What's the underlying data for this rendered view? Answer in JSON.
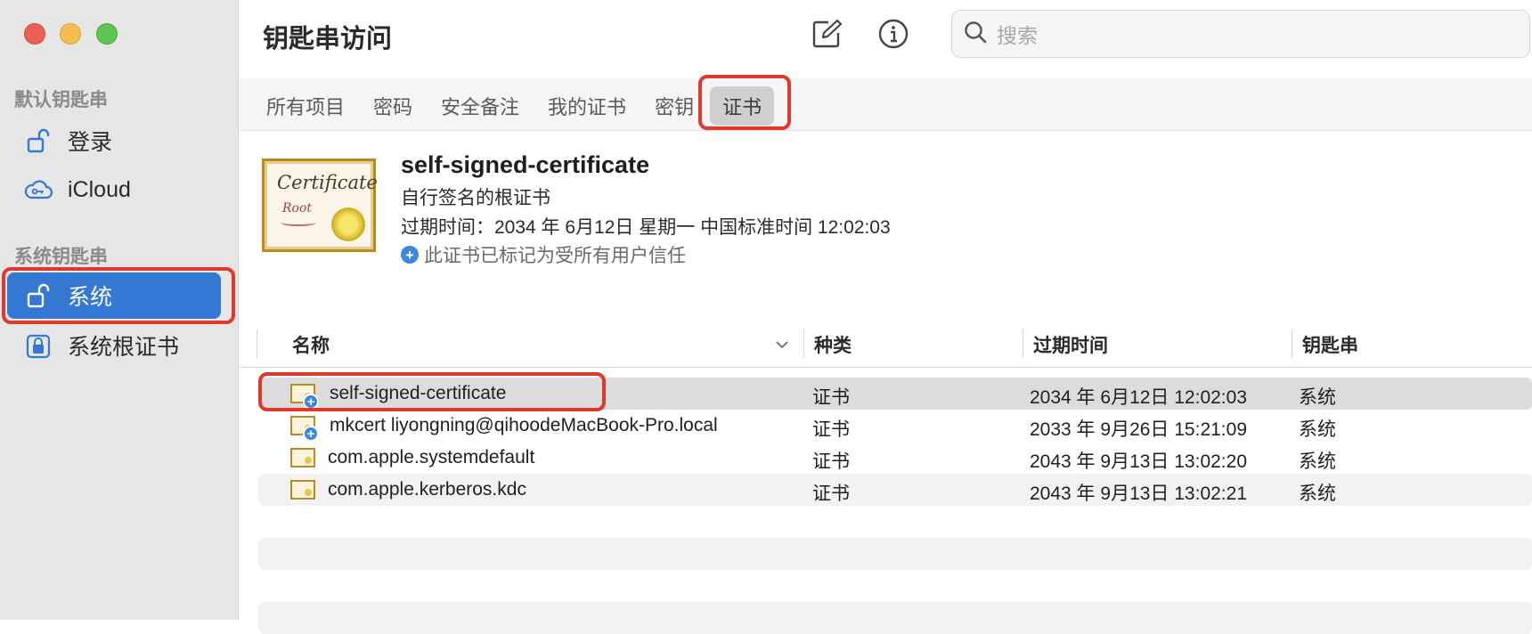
{
  "window": {
    "title": "钥匙串访问"
  },
  "sidebar": {
    "default_section": "默认钥匙串",
    "default_items": [
      {
        "label": "登录",
        "icon": "unlock-icon"
      },
      {
        "label": "iCloud",
        "icon": "cloud-key-icon"
      }
    ],
    "system_section": "系统钥匙串",
    "system_items": [
      {
        "label": "系统",
        "icon": "unlock-icon",
        "selected": true
      },
      {
        "label": "系统根证书",
        "icon": "lock-icon"
      }
    ]
  },
  "toolbar": {
    "compose_icon": "compose-icon",
    "info_icon": "info-icon",
    "search_placeholder": "搜索"
  },
  "tabs": [
    {
      "label": "所有项目"
    },
    {
      "label": "密码"
    },
    {
      "label": "安全备注"
    },
    {
      "label": "我的证书"
    },
    {
      "label": "密钥"
    },
    {
      "label": "证书",
      "active": true
    }
  ],
  "detail": {
    "cert_image_text_1": "Certificate",
    "cert_image_text_2": "Root",
    "name": "self-signed-certificate",
    "kind": "自行签名的根证书",
    "expiry": "过期时间：2034 年 6月12日 星期一 中国标准时间 12:02:03",
    "trust": "此证书已标记为受所有用户信任"
  },
  "table": {
    "columns": [
      "名称",
      "种类",
      "过期时间",
      "钥匙串"
    ],
    "rows": [
      {
        "name": "self-signed-certificate",
        "kind": "证书",
        "expires": "2034 年 6月12日 12:02:03",
        "keychain": "系统",
        "trusted": true
      },
      {
        "name": "mkcert liyongning@qihoodeMacBook-Pro.local",
        "kind": "证书",
        "expires": "2033 年 9月26日 15:21:09",
        "keychain": "系统",
        "trusted": true
      },
      {
        "name": "com.apple.systemdefault",
        "kind": "证书",
        "expires": "2043 年 9月13日 13:02:20",
        "keychain": "系统",
        "trusted": false
      },
      {
        "name": "com.apple.kerberos.kdc",
        "kind": "证书",
        "expires": "2043 年 9月13日 13:02:21",
        "keychain": "系统",
        "trusted": false
      }
    ]
  },
  "colors": {
    "accent": "#3478d4",
    "highlight": "#e0392b"
  }
}
